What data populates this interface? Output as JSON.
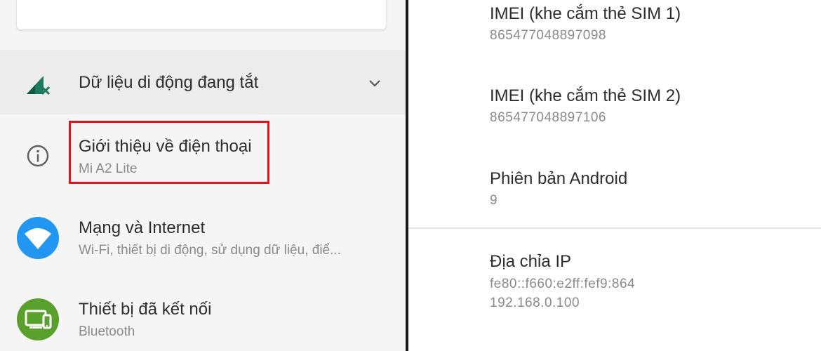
{
  "left": {
    "mobile_data": {
      "label": "Dữ liệu di động đang tắt",
      "icon": "mobile-data-off-icon"
    },
    "about_phone": {
      "title": "Giới thiệu về điện thoại",
      "subtitle": "Mi A2 Lite",
      "icon": "info-icon",
      "highlight_color": "#e3121b"
    },
    "network": {
      "title": "Mạng và Internet",
      "subtitle": "Wi-Fi, thiết bị di động, sử dụng dữ liệu, điể...",
      "icon": "wifi-icon",
      "icon_color": "#2196f3"
    },
    "connected_devices": {
      "title": "Thiết bị đã kết nối",
      "subtitle": "Bluetooth",
      "icon": "connected-devices-icon",
      "icon_color": "#5aa02c"
    }
  },
  "right": {
    "imei1": {
      "title": "IMEI (khe cắm thẻ SIM 1)",
      "value": "865477048897098"
    },
    "imei2": {
      "title": "IMEI (khe cắm thẻ SIM 2)",
      "value": "865477048897106"
    },
    "android": {
      "title": "Phiên bản Android",
      "value": "9"
    },
    "ip": {
      "title": "Địa chỉa IP",
      "value1": "fe80::f660:e2ff:fef9:864",
      "value2": "192.168.0.100"
    }
  }
}
